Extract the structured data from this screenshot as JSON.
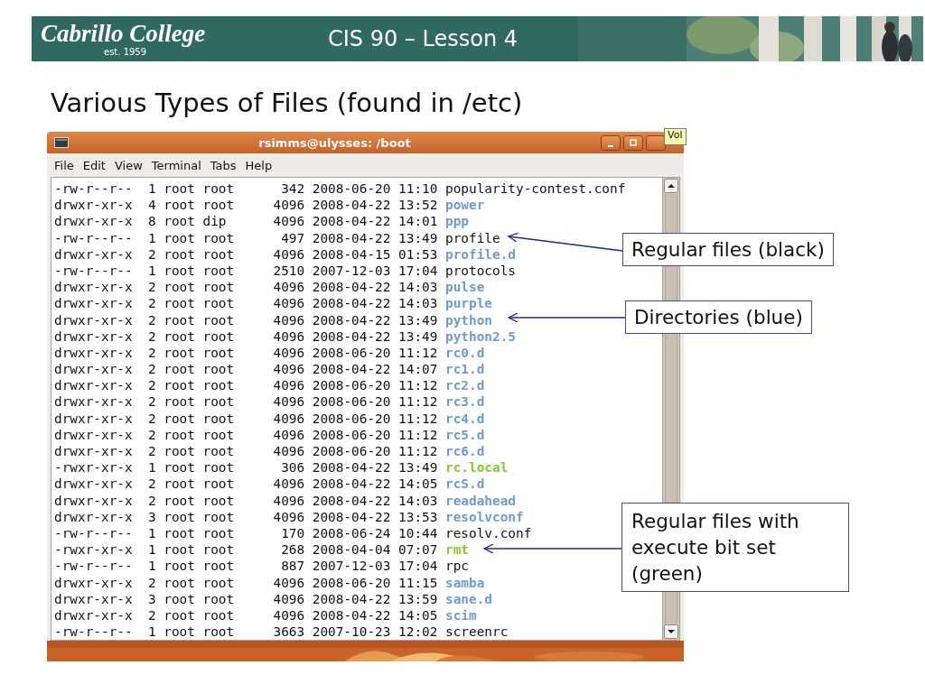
{
  "banner": {
    "logo": "Cabrillo College",
    "logo_tagline": "est. 1959",
    "course": "CIS 90 – Lesson 4",
    "kind": "picture"
  },
  "slide_title": "Various Types of Files (found in /etc)",
  "terminal": {
    "title": "rsimms@ulysses: /boot",
    "tooltip": "Vol",
    "menu": [
      "File",
      "Edit",
      "View",
      "Terminal",
      "Tabs",
      "Help"
    ],
    "rows": [
      {
        "perms": "-rw-r--r--",
        "links": "1",
        "owner": "root",
        "group": "root",
        "size": "342",
        "date": "2008-06-20",
        "time": "11:10",
        "name": "popularity-contest.conf",
        "kind": "file"
      },
      {
        "perms": "drwxr-xr-x",
        "links": "4",
        "owner": "root",
        "group": "root",
        "size": "4096",
        "date": "2008-04-22",
        "time": "13:52",
        "name": "power",
        "kind": "dir"
      },
      {
        "perms": "drwxr-xr-x",
        "links": "8",
        "owner": "root",
        "group": "dip",
        "size": "4096",
        "date": "2008-04-22",
        "time": "14:01",
        "name": "ppp",
        "kind": "dir"
      },
      {
        "perms": "-rw-r--r--",
        "links": "1",
        "owner": "root",
        "group": "root",
        "size": "497",
        "date": "2008-04-22",
        "time": "13:49",
        "name": "profile",
        "kind": "file"
      },
      {
        "perms": "drwxr-xr-x",
        "links": "2",
        "owner": "root",
        "group": "root",
        "size": "4096",
        "date": "2008-04-15",
        "time": "01:53",
        "name": "profile.d",
        "kind": "dir"
      },
      {
        "perms": "-rw-r--r--",
        "links": "1",
        "owner": "root",
        "group": "root",
        "size": "2510",
        "date": "2007-12-03",
        "time": "17:04",
        "name": "protocols",
        "kind": "file"
      },
      {
        "perms": "drwxr-xr-x",
        "links": "2",
        "owner": "root",
        "group": "root",
        "size": "4096",
        "date": "2008-04-22",
        "time": "14:03",
        "name": "pulse",
        "kind": "dir"
      },
      {
        "perms": "drwxr-xr-x",
        "links": "2",
        "owner": "root",
        "group": "root",
        "size": "4096",
        "date": "2008-04-22",
        "time": "14:03",
        "name": "purple",
        "kind": "dir"
      },
      {
        "perms": "drwxr-xr-x",
        "links": "2",
        "owner": "root",
        "group": "root",
        "size": "4096",
        "date": "2008-04-22",
        "time": "13:49",
        "name": "python",
        "kind": "dir"
      },
      {
        "perms": "drwxr-xr-x",
        "links": "2",
        "owner": "root",
        "group": "root",
        "size": "4096",
        "date": "2008-04-22",
        "time": "13:49",
        "name": "python2.5",
        "kind": "dir"
      },
      {
        "perms": "drwxr-xr-x",
        "links": "2",
        "owner": "root",
        "group": "root",
        "size": "4096",
        "date": "2008-06-20",
        "time": "11:12",
        "name": "rc0.d",
        "kind": "dir"
      },
      {
        "perms": "drwxr-xr-x",
        "links": "2",
        "owner": "root",
        "group": "root",
        "size": "4096",
        "date": "2008-04-22",
        "time": "14:07",
        "name": "rc1.d",
        "kind": "dir"
      },
      {
        "perms": "drwxr-xr-x",
        "links": "2",
        "owner": "root",
        "group": "root",
        "size": "4096",
        "date": "2008-06-20",
        "time": "11:12",
        "name": "rc2.d",
        "kind": "dir"
      },
      {
        "perms": "drwxr-xr-x",
        "links": "2",
        "owner": "root",
        "group": "root",
        "size": "4096",
        "date": "2008-06-20",
        "time": "11:12",
        "name": "rc3.d",
        "kind": "dir"
      },
      {
        "perms": "drwxr-xr-x",
        "links": "2",
        "owner": "root",
        "group": "root",
        "size": "4096",
        "date": "2008-06-20",
        "time": "11:12",
        "name": "rc4.d",
        "kind": "dir"
      },
      {
        "perms": "drwxr-xr-x",
        "links": "2",
        "owner": "root",
        "group": "root",
        "size": "4096",
        "date": "2008-06-20",
        "time": "11:12",
        "name": "rc5.d",
        "kind": "dir"
      },
      {
        "perms": "drwxr-xr-x",
        "links": "2",
        "owner": "root",
        "group": "root",
        "size": "4096",
        "date": "2008-06-20",
        "time": "11:12",
        "name": "rc6.d",
        "kind": "dir"
      },
      {
        "perms": "-rwxr-xr-x",
        "links": "1",
        "owner": "root",
        "group": "root",
        "size": "306",
        "date": "2008-04-22",
        "time": "13:49",
        "name": "rc.local",
        "kind": "exec"
      },
      {
        "perms": "drwxr-xr-x",
        "links": "2",
        "owner": "root",
        "group": "root",
        "size": "4096",
        "date": "2008-04-22",
        "time": "14:05",
        "name": "rcS.d",
        "kind": "dir"
      },
      {
        "perms": "drwxr-xr-x",
        "links": "2",
        "owner": "root",
        "group": "root",
        "size": "4096",
        "date": "2008-04-22",
        "time": "14:03",
        "name": "readahead",
        "kind": "dir"
      },
      {
        "perms": "drwxr-xr-x",
        "links": "3",
        "owner": "root",
        "group": "root",
        "size": "4096",
        "date": "2008-04-22",
        "time": "13:53",
        "name": "resolvconf",
        "kind": "dir"
      },
      {
        "perms": "-rw-r--r--",
        "links": "1",
        "owner": "root",
        "group": "root",
        "size": "170",
        "date": "2008-06-24",
        "time": "10:44",
        "name": "resolv.conf",
        "kind": "file"
      },
      {
        "perms": "-rwxr-xr-x",
        "links": "1",
        "owner": "root",
        "group": "root",
        "size": "268",
        "date": "2008-04-04",
        "time": "07:07",
        "name": "rmt",
        "kind": "exec"
      },
      {
        "perms": "-rw-r--r--",
        "links": "1",
        "owner": "root",
        "group": "root",
        "size": "887",
        "date": "2007-12-03",
        "time": "17:04",
        "name": "rpc",
        "kind": "file"
      },
      {
        "perms": "drwxr-xr-x",
        "links": "2",
        "owner": "root",
        "group": "root",
        "size": "4096",
        "date": "2008-06-20",
        "time": "11:15",
        "name": "samba",
        "kind": "dir"
      },
      {
        "perms": "drwxr-xr-x",
        "links": "3",
        "owner": "root",
        "group": "root",
        "size": "4096",
        "date": "2008-04-22",
        "time": "13:59",
        "name": "sane.d",
        "kind": "dir"
      },
      {
        "perms": "drwxr-xr-x",
        "links": "2",
        "owner": "root",
        "group": "root",
        "size": "4096",
        "date": "2008-04-22",
        "time": "14:05",
        "name": "scim",
        "kind": "dir"
      },
      {
        "perms": "-rw-r--r--",
        "links": "1",
        "owner": "root",
        "group": "root",
        "size": "3663",
        "date": "2007-10-23",
        "time": "12:02",
        "name": "screenrc",
        "kind": "file"
      }
    ]
  },
  "callouts": [
    {
      "text": "Regular files (black)",
      "kind": "top"
    },
    {
      "text": "Directories (blue)",
      "kind": "middle"
    },
    {
      "text": "Regular files with execute bit set (green)",
      "kind": "bottom"
    }
  ]
}
